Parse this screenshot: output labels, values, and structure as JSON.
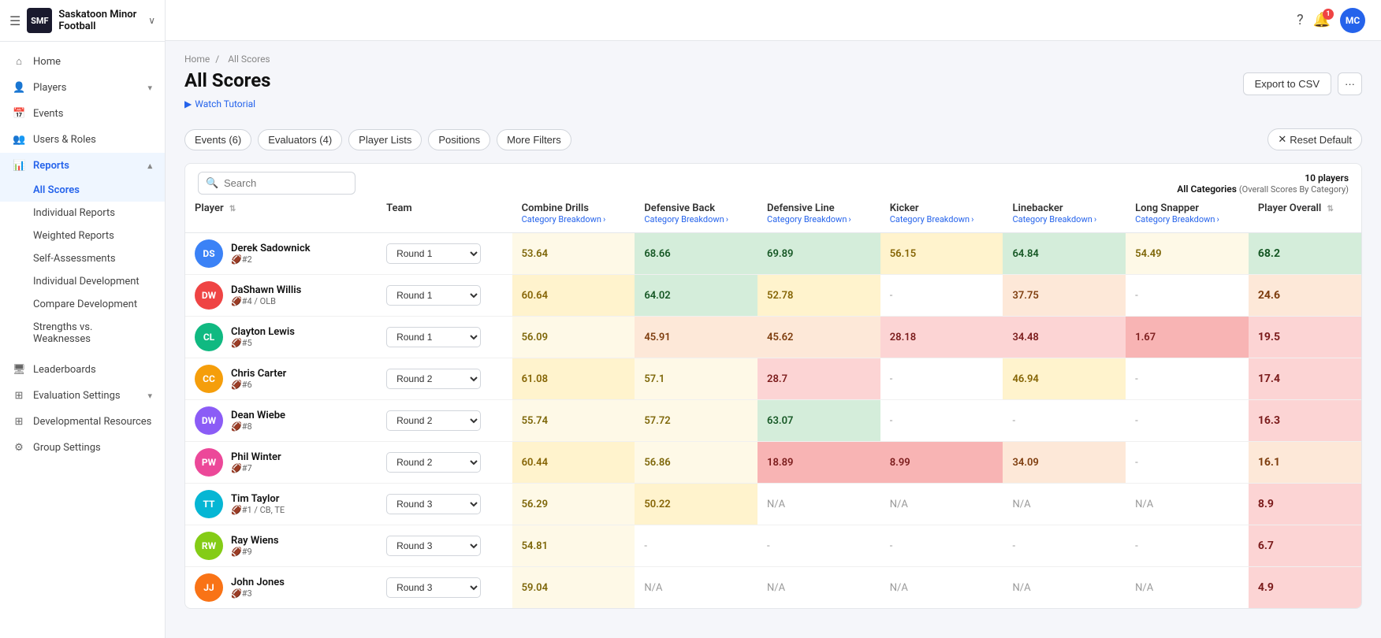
{
  "app": {
    "org_name": "Saskatoon Minor Football",
    "logo_text": "SMF",
    "user_initials": "MC",
    "notification_count": "1"
  },
  "topbar": {
    "help_icon": "?",
    "bell_icon": "🔔"
  },
  "sidebar": {
    "nav_items": [
      {
        "id": "home",
        "label": "Home",
        "icon": "⌂",
        "active": false
      },
      {
        "id": "players",
        "label": "Players",
        "icon": "👤",
        "active": false,
        "arrow": "▾"
      },
      {
        "id": "events",
        "label": "Events",
        "icon": "📅",
        "active": false
      },
      {
        "id": "users-roles",
        "label": "Users & Roles",
        "icon": "👥",
        "active": false
      },
      {
        "id": "reports",
        "label": "Reports",
        "icon": "📊",
        "active": true,
        "arrow": "▴"
      }
    ],
    "sub_nav": [
      {
        "id": "all-scores",
        "label": "All Scores",
        "active": true
      },
      {
        "id": "individual-reports",
        "label": "Individual Reports",
        "active": false
      },
      {
        "id": "weighted-reports",
        "label": "Weighted Reports",
        "active": false
      },
      {
        "id": "self-assessments",
        "label": "Self-Assessments",
        "active": false
      },
      {
        "id": "individual-development",
        "label": "Individual Development",
        "active": false
      },
      {
        "id": "compare-development",
        "label": "Compare Development",
        "active": false
      },
      {
        "id": "strengths-weaknesses",
        "label": "Strengths vs. Weaknesses",
        "active": false
      }
    ],
    "bottom_nav": [
      {
        "id": "leaderboards",
        "label": "Leaderboards",
        "icon": "🖥"
      },
      {
        "id": "evaluation-settings",
        "label": "Evaluation Settings",
        "icon": "⊞",
        "arrow": "▾"
      },
      {
        "id": "developmental-resources",
        "label": "Developmental Resources",
        "icon": "⊞"
      },
      {
        "id": "group-settings",
        "label": "Group Settings",
        "icon": "⚙"
      }
    ]
  },
  "breadcrumb": {
    "home": "Home",
    "current": "All Scores"
  },
  "page": {
    "title": "All Scores",
    "watch_label": "Watch Tutorial",
    "export_label": "Export to CSV"
  },
  "filters": {
    "events": "Events (6)",
    "evaluators": "Evaluators (4)",
    "player_lists": "Player Lists",
    "positions": "Positions",
    "more": "More Filters",
    "reset": "Reset Default"
  },
  "table": {
    "search_placeholder": "Search",
    "player_count": "10 players",
    "categories_label": "All Categories",
    "categories_sub": "(Overall Scores By Category)",
    "columns": {
      "player": "Player",
      "team": "Team",
      "combine_drills": "Combine Drills",
      "defensive_back": "Defensive Back",
      "defensive_line": "Defensive Line",
      "kicker": "Kicker",
      "linebacker": "Linebacker",
      "long_snapper": "Long Snapper",
      "player_overall": "Player Overall"
    },
    "category_breakdown": "Category Breakdown",
    "rows": [
      {
        "name": "Derek Sadownick",
        "number": "#2",
        "position": "",
        "team": "Round 1",
        "combine_drills": "53.64",
        "defensive_back": "68.66",
        "defensive_line": "69.89",
        "kicker": "56.15",
        "linebacker": "64.84",
        "long_snapper": "54.49",
        "player_overall": "68.2",
        "cd_color": "yellow-light",
        "db_color": "green-light",
        "dl_color": "green-light",
        "ki_color": "yellow",
        "lb_color": "green-light",
        "ls_color": "yellow-light",
        "po_color": "green-light"
      },
      {
        "name": "DaShawn Willis",
        "number": "#4 / OLB",
        "position": "OLB",
        "team": "Round 1",
        "combine_drills": "60.64",
        "defensive_back": "64.02",
        "defensive_line": "52.78",
        "kicker": "-",
        "linebacker": "37.75",
        "long_snapper": "-",
        "player_overall": "24.6",
        "cd_color": "yellow",
        "db_color": "green-light",
        "dl_color": "yellow",
        "ki_color": "neutral",
        "lb_color": "orange",
        "ls_color": "neutral",
        "po_color": "orange"
      },
      {
        "name": "Clayton Lewis",
        "number": "#5",
        "position": "",
        "team": "Round 1",
        "combine_drills": "56.09",
        "defensive_back": "45.91",
        "defensive_line": "45.62",
        "kicker": "28.18",
        "linebacker": "34.48",
        "long_snapper": "1.67",
        "player_overall": "19.5",
        "cd_color": "yellow-light",
        "db_color": "orange",
        "dl_color": "orange",
        "ki_color": "red",
        "lb_color": "red",
        "ls_color": "red-dark",
        "po_color": "red"
      },
      {
        "name": "Chris Carter",
        "number": "#6",
        "position": "",
        "team": "Round 2",
        "combine_drills": "61.08",
        "defensive_back": "57.1",
        "defensive_line": "28.7",
        "kicker": "-",
        "linebacker": "46.94",
        "long_snapper": "-",
        "player_overall": "17.4",
        "cd_color": "yellow",
        "db_color": "yellow-light",
        "dl_color": "red",
        "ki_color": "neutral",
        "lb_color": "yellow",
        "ls_color": "neutral",
        "po_color": "red"
      },
      {
        "name": "Dean Wiebe",
        "number": "#8",
        "position": "",
        "team": "Round 2",
        "combine_drills": "55.74",
        "defensive_back": "57.72",
        "defensive_line": "63.07",
        "kicker": "-",
        "linebacker": "-",
        "long_snapper": "-",
        "player_overall": "16.3",
        "cd_color": "yellow-light",
        "db_color": "yellow-light",
        "dl_color": "green-light",
        "ki_color": "neutral",
        "lb_color": "neutral",
        "ls_color": "neutral",
        "po_color": "red"
      },
      {
        "name": "Phil Winter",
        "number": "#7",
        "position": "",
        "team": "Round 2",
        "combine_drills": "60.44",
        "defensive_back": "56.86",
        "defensive_line": "18.89",
        "kicker": "8.99",
        "linebacker": "34.09",
        "long_snapper": "-",
        "player_overall": "16.1",
        "cd_color": "yellow",
        "db_color": "yellow-light",
        "dl_color": "red-dark",
        "ki_color": "red-dark",
        "lb_color": "orange",
        "ls_color": "neutral",
        "po_color": "orange"
      },
      {
        "name": "Tim Taylor",
        "number": "#1 / CB, TE",
        "position": "CB, TE",
        "team": "Round 3",
        "combine_drills": "56.29",
        "defensive_back": "50.22",
        "defensive_line": "N/A",
        "kicker": "N/A",
        "linebacker": "N/A",
        "long_snapper": "N/A",
        "player_overall": "8.9",
        "cd_color": "yellow-light",
        "db_color": "yellow",
        "dl_color": "neutral",
        "ki_color": "neutral",
        "lb_color": "neutral",
        "ls_color": "neutral",
        "po_color": "red"
      },
      {
        "name": "Ray Wiens",
        "number": "#9",
        "position": "",
        "team": "Round 3",
        "combine_drills": "54.81",
        "defensive_back": "-",
        "defensive_line": "-",
        "kicker": "-",
        "linebacker": "-",
        "long_snapper": "-",
        "player_overall": "6.7",
        "cd_color": "yellow-light",
        "db_color": "neutral",
        "dl_color": "neutral",
        "ki_color": "neutral",
        "lb_color": "neutral",
        "ls_color": "neutral",
        "po_color": "red"
      },
      {
        "name": "John Jones",
        "number": "#3",
        "position": "",
        "team": "Round 3",
        "combine_drills": "59.04",
        "defensive_back": "N/A",
        "defensive_line": "N/A",
        "kicker": "N/A",
        "linebacker": "N/A",
        "long_snapper": "N/A",
        "player_overall": "4.9",
        "cd_color": "yellow-light",
        "db_color": "neutral",
        "dl_color": "neutral",
        "ki_color": "neutral",
        "lb_color": "neutral",
        "ls_color": "neutral",
        "po_color": "red"
      }
    ]
  }
}
